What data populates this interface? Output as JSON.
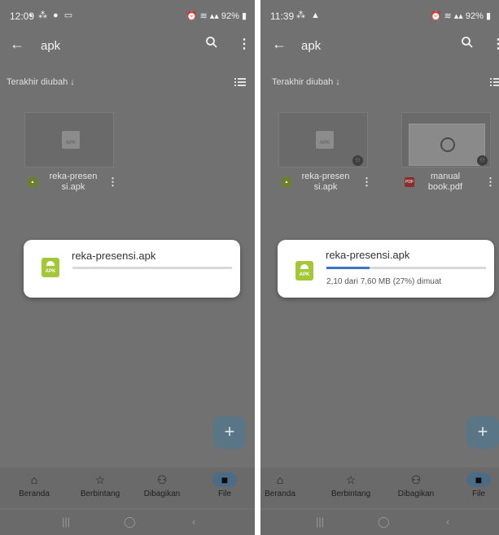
{
  "left": {
    "status_time": "12:09",
    "status_battery": "92%",
    "search_query": "apk",
    "sort_label": "Terakhir diubah ↓",
    "file": {
      "name_line1": "reka-presen",
      "name_line2": "si.apk"
    },
    "dialog": {
      "title": "reka-presensi.apk",
      "progress": 0
    },
    "nav": [
      "Beranda",
      "Berbintang",
      "Dibagikan",
      "File"
    ]
  },
  "right": {
    "status_time": "11:39",
    "status_battery": "92%",
    "search_query": "apk",
    "sort_label": "Terakhir diubah ↓",
    "files": [
      {
        "name_line1": "reka-presen",
        "name_line2": "si.apk"
      },
      {
        "name_line1": "manual",
        "name_line2": "book.pdf"
      }
    ],
    "dialog": {
      "title": "reka-presensi.apk",
      "status": "2,10 dari 7,60 MB (27%) dimuat",
      "progress": 0.27
    },
    "nav": [
      "Beranda",
      "Berbintang",
      "Dibagikan",
      "File"
    ]
  },
  "icons": {
    "back": "arrow-left-icon",
    "search": "search-icon",
    "more": "vertical-dots-icon",
    "list_view": "list-view-icon",
    "home": "home-icon",
    "star": "star-icon",
    "shared": "people-icon",
    "folder": "folder-icon",
    "add": "plus-icon"
  },
  "colors": {
    "progress_fill": "#3d73c4",
    "apk_green": "#a4c639",
    "active_nav": "#4c6b85"
  }
}
